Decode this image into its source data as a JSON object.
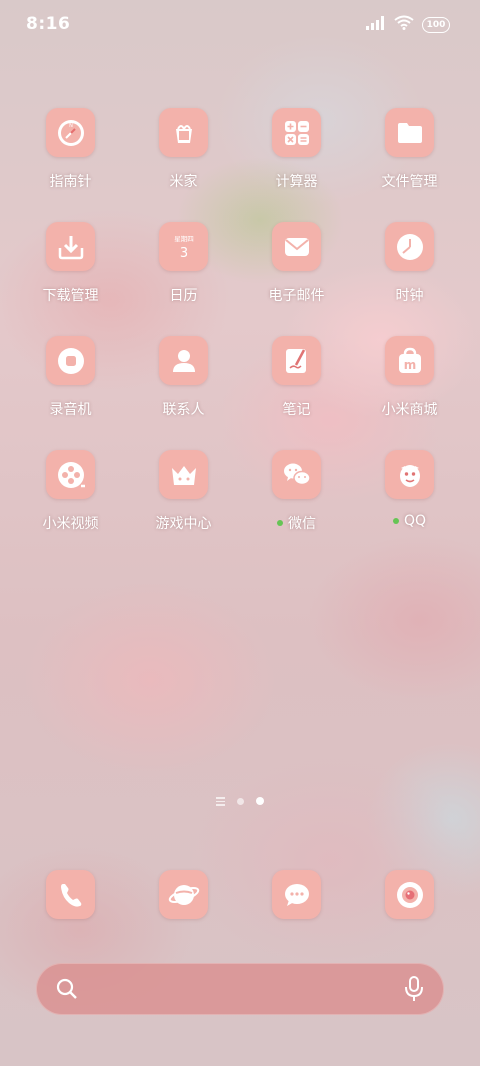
{
  "status": {
    "time": "8:16",
    "battery": "100"
  },
  "apps": [
    {
      "label": "指南针",
      "icon": "compass-icon"
    },
    {
      "label": "米家",
      "icon": "mijia-icon"
    },
    {
      "label": "计算器",
      "icon": "calculator-icon"
    },
    {
      "label": "文件管理",
      "icon": "folder-icon"
    },
    {
      "label": "下载管理",
      "icon": "download-icon"
    },
    {
      "label": "日历",
      "icon": "calendar-icon",
      "calendar_weekday": "星期四",
      "calendar_day": "3"
    },
    {
      "label": "电子邮件",
      "icon": "mail-icon"
    },
    {
      "label": "时钟",
      "icon": "clock-icon"
    },
    {
      "label": "录音机",
      "icon": "recorder-icon"
    },
    {
      "label": "联系人",
      "icon": "contacts-icon"
    },
    {
      "label": "笔记",
      "icon": "notes-icon"
    },
    {
      "label": "小米商城",
      "icon": "store-icon",
      "store_letter": "m"
    },
    {
      "label": "小米视频",
      "icon": "video-icon"
    },
    {
      "label": "游戏中心",
      "icon": "game-center-icon"
    },
    {
      "label": "微信",
      "icon": "wechat-icon",
      "badge_color": "#66c455"
    },
    {
      "label": "QQ",
      "icon": "qq-icon",
      "badge_color": "#66c455"
    }
  ],
  "page_indicator": {
    "pages": 2,
    "active": 2
  },
  "dock": [
    {
      "icon": "phone-icon"
    },
    {
      "icon": "browser-icon"
    },
    {
      "icon": "messages-icon"
    },
    {
      "icon": "camera-icon"
    }
  ],
  "colors": {
    "icon_bg": "#f3b2ab",
    "icon_glyph": "#ffffff",
    "search_bar": "#d99292",
    "badge": "#66c455"
  }
}
